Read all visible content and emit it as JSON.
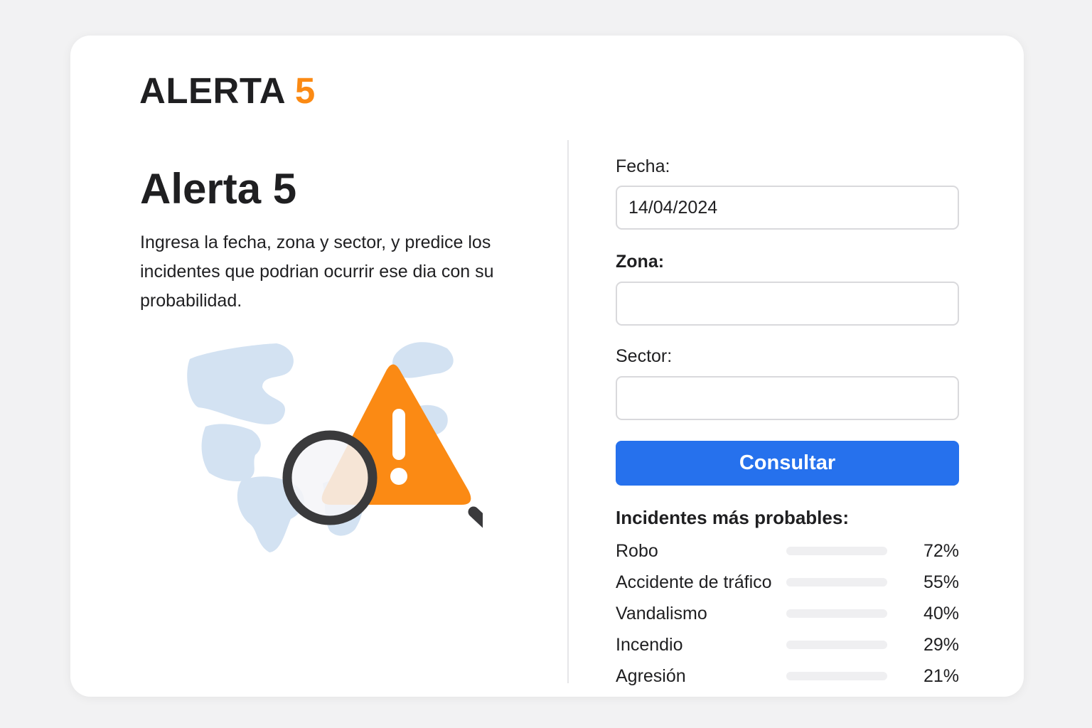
{
  "brand": {
    "name": "ALERTA",
    "number": "5",
    "accent_color": "#fb8a14"
  },
  "hero": {
    "title": "Alerta 5",
    "description": "Ingresa la fecha, zona y sector, y predice los incidentes que podrian ocurrir ese dia con su probabilidad.",
    "illustration": "warning-triangle-with-magnifier-over-map"
  },
  "form": {
    "fecha": {
      "label": "Fecha:",
      "value": "14/04/2024"
    },
    "zona": {
      "label": "Zona:",
      "value": ""
    },
    "sector": {
      "label": "Sector:",
      "value": ""
    },
    "submit_label": "Consultar",
    "button_color": "#2671ed"
  },
  "results": {
    "title": "Incidentes más probables:",
    "items": [
      {
        "name": "Robo",
        "probability": "72%",
        "fraction": 0.72
      },
      {
        "name": "Accidente de tráfico",
        "probability": "55%",
        "fraction": 0.55
      },
      {
        "name": "Vandalismo",
        "probability": "40%",
        "fraction": 0.4
      },
      {
        "name": "Incendio",
        "probability": "29%",
        "fraction": 0.29
      },
      {
        "name": "Agresión",
        "probability": "21%",
        "fraction": 0.21
      }
    ]
  }
}
